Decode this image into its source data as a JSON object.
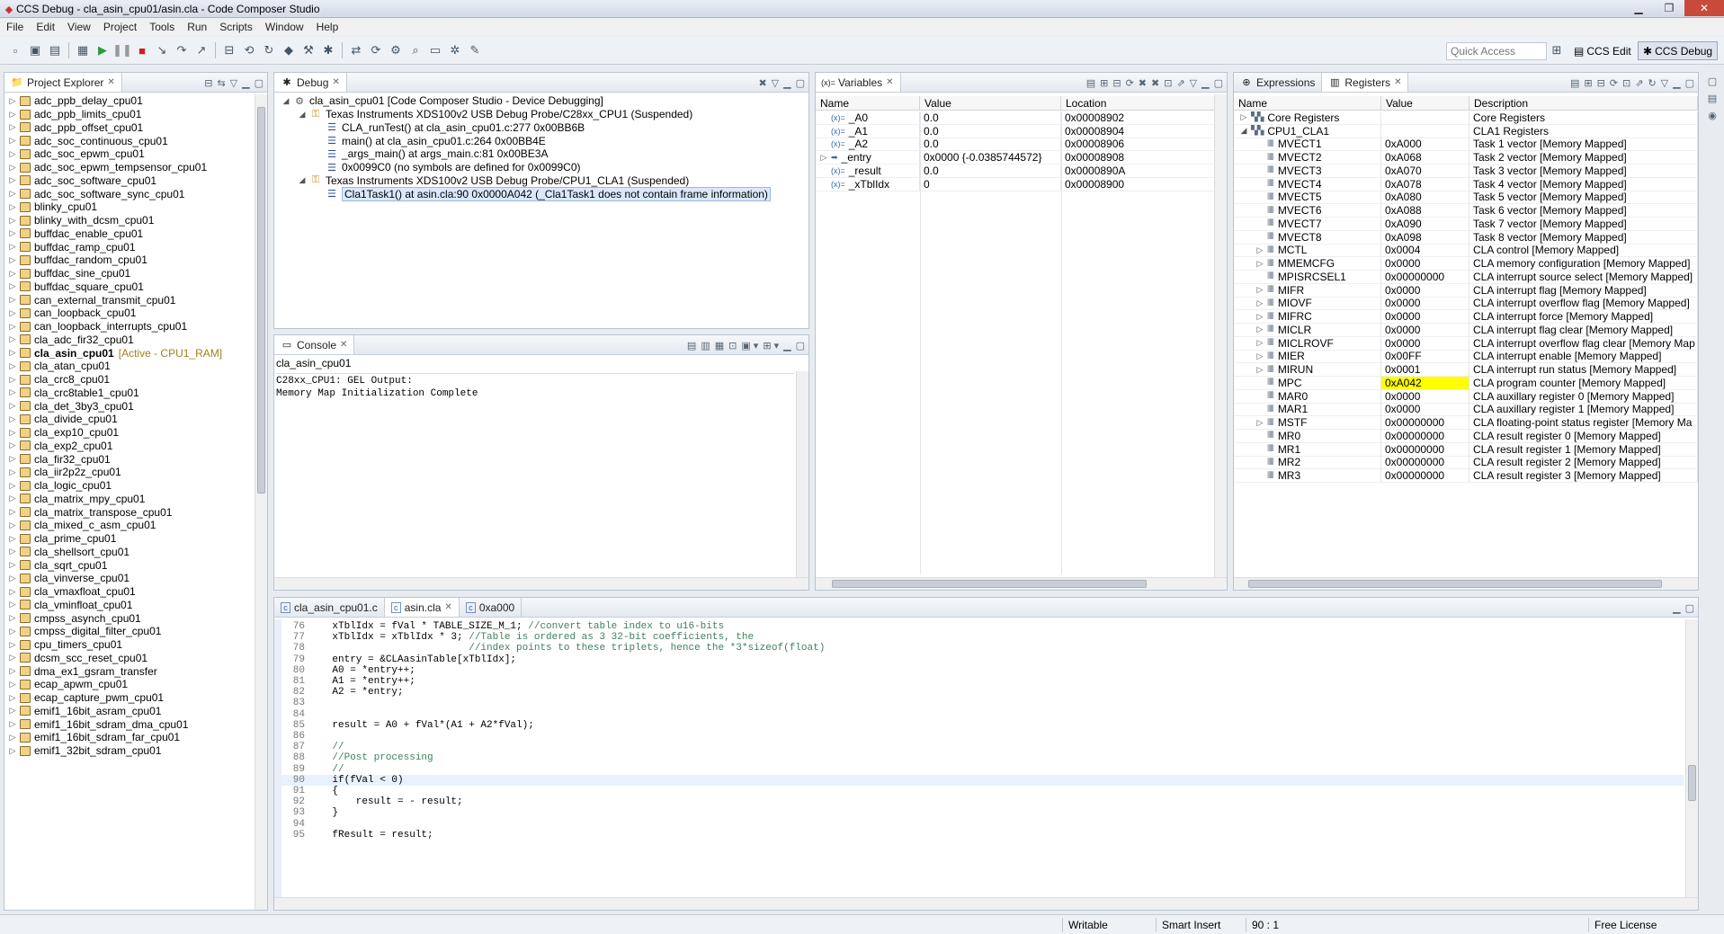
{
  "window": {
    "title": "CCS Debug - cla_asin_cpu01/asin.cla - Code Composer Studio"
  },
  "menu": [
    "File",
    "Edit",
    "View",
    "Project",
    "Tools",
    "Run",
    "Scripts",
    "Window",
    "Help"
  ],
  "toolbar": {
    "quick_access_placeholder": "Quick Access",
    "persp_edit": "CCS Edit",
    "persp_debug": "CCS Debug"
  },
  "project_explorer": {
    "tab": "Project Explorer",
    "items": [
      {
        "name": "adc_ppb_delay_cpu01"
      },
      {
        "name": "adc_ppb_limits_cpu01"
      },
      {
        "name": "adc_ppb_offset_cpu01"
      },
      {
        "name": "adc_soc_continuous_cpu01"
      },
      {
        "name": "adc_soc_epwm_cpu01"
      },
      {
        "name": "adc_soc_epwm_tempsensor_cpu01"
      },
      {
        "name": "adc_soc_software_cpu01"
      },
      {
        "name": "adc_soc_software_sync_cpu01"
      },
      {
        "name": "blinky_cpu01"
      },
      {
        "name": "blinky_with_dcsm_cpu01"
      },
      {
        "name": "buffdac_enable_cpu01"
      },
      {
        "name": "buffdac_ramp_cpu01"
      },
      {
        "name": "buffdac_random_cpu01"
      },
      {
        "name": "buffdac_sine_cpu01"
      },
      {
        "name": "buffdac_square_cpu01"
      },
      {
        "name": "can_external_transmit_cpu01"
      },
      {
        "name": "can_loopback_cpu01"
      },
      {
        "name": "can_loopback_interrupts_cpu01"
      },
      {
        "name": "cla_adc_fir32_cpu01"
      },
      {
        "name": "cla_asin_cpu01",
        "active": "[Active - CPU1_RAM]"
      },
      {
        "name": "cla_atan_cpu01"
      },
      {
        "name": "cla_crc8_cpu01"
      },
      {
        "name": "cla_crc8table1_cpu01"
      },
      {
        "name": "cla_det_3by3_cpu01"
      },
      {
        "name": "cla_divide_cpu01"
      },
      {
        "name": "cla_exp10_cpu01"
      },
      {
        "name": "cla_exp2_cpu01"
      },
      {
        "name": "cla_fir32_cpu01"
      },
      {
        "name": "cla_iir2p2z_cpu01"
      },
      {
        "name": "cla_logic_cpu01"
      },
      {
        "name": "cla_matrix_mpy_cpu01"
      },
      {
        "name": "cla_matrix_transpose_cpu01"
      },
      {
        "name": "cla_mixed_c_asm_cpu01"
      },
      {
        "name": "cla_prime_cpu01"
      },
      {
        "name": "cla_shellsort_cpu01"
      },
      {
        "name": "cla_sqrt_cpu01"
      },
      {
        "name": "cla_vinverse_cpu01"
      },
      {
        "name": "cla_vmaxfloat_cpu01"
      },
      {
        "name": "cla_vminfloat_cpu01"
      },
      {
        "name": "cmpss_asynch_cpu01"
      },
      {
        "name": "cmpss_digital_filter_cpu01"
      },
      {
        "name": "cpu_timers_cpu01"
      },
      {
        "name": "dcsm_scc_reset_cpu01"
      },
      {
        "name": "dma_ex1_gsram_transfer"
      },
      {
        "name": "ecap_apwm_cpu01"
      },
      {
        "name": "ecap_capture_pwm_cpu01"
      },
      {
        "name": "emif1_16bit_asram_cpu01"
      },
      {
        "name": "emif1_16bit_sdram_dma_cpu01"
      },
      {
        "name": "emif1_16bit_sdram_far_cpu01"
      },
      {
        "name": "emif1_32bit_sdram_cpu01"
      }
    ]
  },
  "debug": {
    "tab": "Debug",
    "rows": [
      {
        "indent": 0,
        "icon": "gear",
        "text": "cla_asin_cpu01 [Code Composer Studio - Device Debugging]"
      },
      {
        "indent": 1,
        "icon": "probe",
        "text": "Texas Instruments XDS100v2 USB Debug Probe/C28xx_CPU1 (Suspended)"
      },
      {
        "indent": 2,
        "icon": "frame",
        "text": "CLA_runTest() at cla_asin_cpu01.c:277 0x00BB6B"
      },
      {
        "indent": 2,
        "icon": "frame",
        "text": "main() at cla_asin_cpu01.c:264 0x00BB4E"
      },
      {
        "indent": 2,
        "icon": "frame",
        "text": "_args_main() at args_main.c:81 0x00BE3A"
      },
      {
        "indent": 2,
        "icon": "frame",
        "text": "0x0099C0  (no symbols are defined for 0x0099C0)"
      },
      {
        "indent": 1,
        "icon": "probe",
        "text": "Texas Instruments XDS100v2 USB Debug Probe/CPU1_CLA1 (Suspended)"
      },
      {
        "indent": 2,
        "icon": "frame",
        "text": "Cla1Task1() at asin.cla:90 0x0000A042  (_Cla1Task1 does not contain frame information)",
        "selected": true
      }
    ]
  },
  "variables": {
    "tab": "Variables",
    "headers": [
      "Name",
      "Value",
      "Location"
    ],
    "rows": [
      {
        "name": "_A0",
        "value": "0.0",
        "location": "0x00008902"
      },
      {
        "name": "_A1",
        "value": "0.0",
        "location": "0x00008904"
      },
      {
        "name": "_A2",
        "value": "0.0",
        "location": "0x00008906"
      },
      {
        "name": "_entry",
        "value": "0x0000 {-0.0385744572}",
        "location": "0x00008908",
        "pointer": true
      },
      {
        "name": "_result",
        "value": "0.0",
        "location": "0x0000890A"
      },
      {
        "name": "_xTblIdx",
        "value": "0",
        "location": "0x00008900"
      }
    ]
  },
  "registers": {
    "tab_expr": "Expressions",
    "tab": "Registers",
    "headers": [
      "Name",
      "Value",
      "Description"
    ],
    "rows": [
      {
        "lvl": 0,
        "exp": "▷",
        "name": "Core Registers",
        "value": "",
        "desc": "Core Registers"
      },
      {
        "lvl": 0,
        "exp": "◢",
        "name": "CPU1_CLA1",
        "value": "",
        "desc": "CLA1 Registers"
      },
      {
        "lvl": 1,
        "exp": "",
        "name": "MVECT1",
        "value": "0xA000",
        "desc": "Task 1 vector [Memory Mapped]"
      },
      {
        "lvl": 1,
        "exp": "",
        "name": "MVECT2",
        "value": "0xA068",
        "desc": "Task 2 vector [Memory Mapped]"
      },
      {
        "lvl": 1,
        "exp": "",
        "name": "MVECT3",
        "value": "0xA070",
        "desc": "Task 3 vector [Memory Mapped]"
      },
      {
        "lvl": 1,
        "exp": "",
        "name": "MVECT4",
        "value": "0xA078",
        "desc": "Task 4 vector [Memory Mapped]"
      },
      {
        "lvl": 1,
        "exp": "",
        "name": "MVECT5",
        "value": "0xA080",
        "desc": "Task 5 vector [Memory Mapped]"
      },
      {
        "lvl": 1,
        "exp": "",
        "name": "MVECT6",
        "value": "0xA088",
        "desc": "Task 6 vector [Memory Mapped]"
      },
      {
        "lvl": 1,
        "exp": "",
        "name": "MVECT7",
        "value": "0xA090",
        "desc": "Task 7 vector [Memory Mapped]"
      },
      {
        "lvl": 1,
        "exp": "",
        "name": "MVECT8",
        "value": "0xA098",
        "desc": "Task 8 vector [Memory Mapped]"
      },
      {
        "lvl": 1,
        "exp": "▷",
        "name": "MCTL",
        "value": "0x0004",
        "desc": "CLA control [Memory Mapped]"
      },
      {
        "lvl": 1,
        "exp": "▷",
        "name": "MMEMCFG",
        "value": "0x0000",
        "desc": "CLA memory configuration [Memory Mapped]"
      },
      {
        "lvl": 1,
        "exp": "",
        "name": "MPISRCSEL1",
        "value": "0x00000000",
        "desc": "CLA interrupt source select [Memory Mapped]"
      },
      {
        "lvl": 1,
        "exp": "▷",
        "name": "MIFR",
        "value": "0x0000",
        "desc": "CLA interrupt flag [Memory Mapped]"
      },
      {
        "lvl": 1,
        "exp": "▷",
        "name": "MIOVF",
        "value": "0x0000",
        "desc": "CLA interrupt overflow flag [Memory Mapped]"
      },
      {
        "lvl": 1,
        "exp": "▷",
        "name": "MIFRC",
        "value": "0x0000",
        "desc": "CLA interrupt force [Memory Mapped]"
      },
      {
        "lvl": 1,
        "exp": "▷",
        "name": "MICLR",
        "value": "0x0000",
        "desc": "CLA interrupt flag clear [Memory Mapped]"
      },
      {
        "lvl": 1,
        "exp": "▷",
        "name": "MICLROVF",
        "value": "0x0000",
        "desc": "CLA interrupt overflow flag clear [Memory Map"
      },
      {
        "lvl": 1,
        "exp": "▷",
        "name": "MIER",
        "value": "0x00FF",
        "desc": "CLA interrupt enable [Memory Mapped]"
      },
      {
        "lvl": 1,
        "exp": "▷",
        "name": "MIRUN",
        "value": "0x0001",
        "desc": "CLA interrupt run status [Memory Mapped]"
      },
      {
        "lvl": 1,
        "exp": "",
        "name": "MPC",
        "value": "0xA042",
        "desc": "CLA program counter [Memory Mapped]",
        "highlight": true
      },
      {
        "lvl": 1,
        "exp": "",
        "name": "MAR0",
        "value": "0x0000",
        "desc": "CLA auxillary register 0 [Memory Mapped]"
      },
      {
        "lvl": 1,
        "exp": "",
        "name": "MAR1",
        "value": "0x0000",
        "desc": "CLA auxillary register 1 [Memory Mapped]"
      },
      {
        "lvl": 1,
        "exp": "▷",
        "name": "MSTF",
        "value": "0x00000000",
        "desc": "CLA floating-point status register [Memory Ma"
      },
      {
        "lvl": 1,
        "exp": "",
        "name": "MR0",
        "value": "0x00000000",
        "desc": "CLA result register 0 [Memory Mapped]"
      },
      {
        "lvl": 1,
        "exp": "",
        "name": "MR1",
        "value": "0x00000000",
        "desc": "CLA result register 1 [Memory Mapped]"
      },
      {
        "lvl": 1,
        "exp": "",
        "name": "MR2",
        "value": "0x00000000",
        "desc": "CLA result register 2 [Memory Mapped]"
      },
      {
        "lvl": 1,
        "exp": "",
        "name": "MR3",
        "value": "0x00000000",
        "desc": "CLA result register 3 [Memory Mapped]"
      }
    ]
  },
  "console": {
    "tab": "Console",
    "title": "cla_asin_cpu01",
    "lines": [
      "C28xx_CPU1: GEL Output:",
      "Memory Map Initialization Complete"
    ]
  },
  "editor": {
    "tabs": [
      {
        "label": "cla_asin_cpu01.c",
        "active": false
      },
      {
        "label": "asin.cla",
        "active": true
      },
      {
        "label": "0xa000",
        "active": false
      }
    ],
    "lines": [
      {
        "n": "76",
        "t": "    xTblIdx = fVal * TABLE_SIZE_M_1; //convert table index to u16-bits"
      },
      {
        "n": "77",
        "t": "    xTblIdx = xTblIdx * 3; //Table is ordered as 3 32-bit coefficients, the"
      },
      {
        "n": "78",
        "t": "                           //index points to these triplets, hence the *3*sizeof(float)"
      },
      {
        "n": "79",
        "t": "    entry = &CLAasinTable[xTblIdx];"
      },
      {
        "n": "80",
        "t": "    A0 = *entry++;"
      },
      {
        "n": "81",
        "t": "    A1 = *entry++;"
      },
      {
        "n": "82",
        "t": "    A2 = *entry;"
      },
      {
        "n": "83",
        "t": ""
      },
      {
        "n": "84",
        "t": ""
      },
      {
        "n": "85",
        "t": "    result = A0 + fVal*(A1 + A2*fVal);"
      },
      {
        "n": "86",
        "t": ""
      },
      {
        "n": "87",
        "t": "    //"
      },
      {
        "n": "88",
        "t": "    //Post processing"
      },
      {
        "n": "89",
        "t": "    //"
      },
      {
        "n": "90",
        "t": "    if(fVal < 0)",
        "current": true
      },
      {
        "n": "91",
        "t": "    {"
      },
      {
        "n": "92",
        "t": "        result = - result;"
      },
      {
        "n": "93",
        "t": "    }"
      },
      {
        "n": "94",
        "t": ""
      },
      {
        "n": "95",
        "t": "    fResult = result;"
      }
    ]
  },
  "status": {
    "writable": "Writable",
    "insert": "Smart Insert",
    "position": "90 : 1",
    "license": "Free License"
  },
  "colors": {
    "highlight": "#ffff00",
    "selection": "#dbe8fb",
    "accent": "#3c6dbf"
  }
}
